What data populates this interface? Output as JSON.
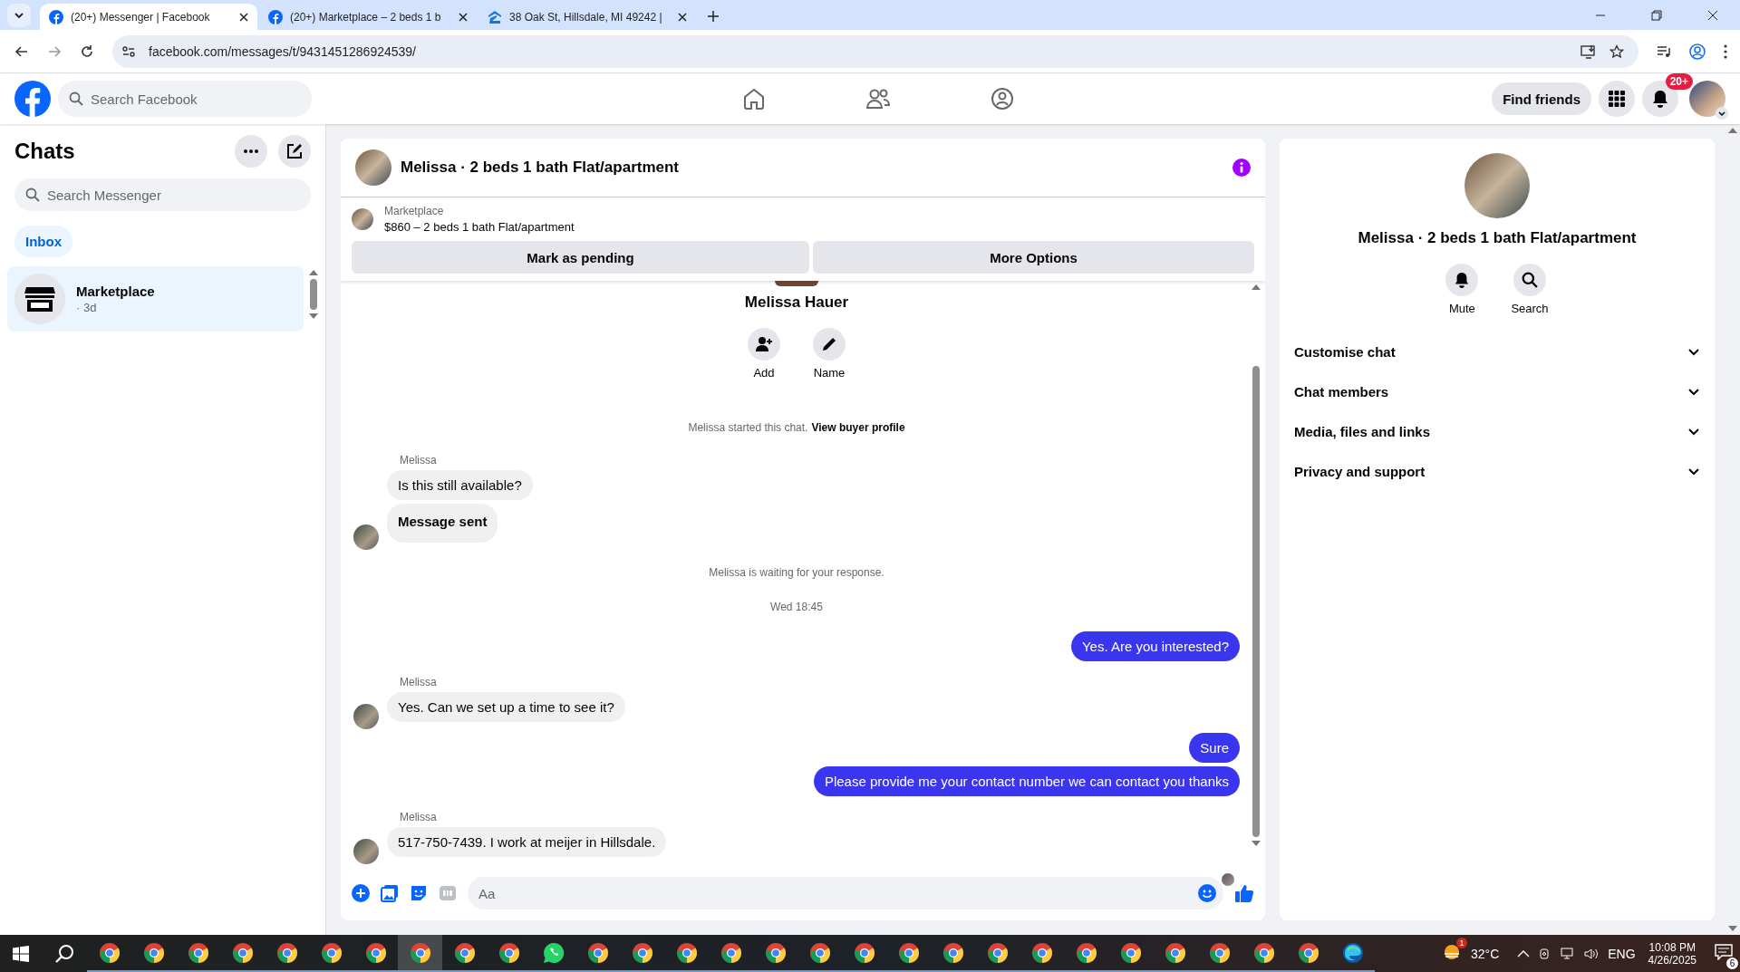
{
  "browser": {
    "tabs": [
      {
        "title": "(20+) Messenger | Facebook",
        "kind": "facebook",
        "selected": true
      },
      {
        "title": "(20+) Marketplace – 2 beds 1 b",
        "kind": "facebook",
        "selected": false
      },
      {
        "title": "38 Oak St, Hillsdale, MI 49242 |",
        "kind": "zillow",
        "selected": false
      }
    ],
    "url": "facebook.com/messages/t/9431451286924539/"
  },
  "header": {
    "search": {
      "placeholder": "Search Facebook"
    },
    "nav": [
      {
        "kind": "home"
      },
      {
        "kind": "friends"
      },
      {
        "kind": "groups"
      }
    ],
    "find_friends": "Find friends",
    "notification_badge": "20+"
  },
  "sidebar": {
    "title": "Chats",
    "search": {
      "placeholder": "Search Messenger"
    },
    "filter": {
      "label": "Inbox",
      "selected": true
    },
    "chats": [
      {
        "name": "Marketplace",
        "time": "· 3d",
        "selected": true
      }
    ]
  },
  "conversation": {
    "title": "Melissa · 2 beds 1 bath Flat/apartment",
    "listing": {
      "source": "Marketplace",
      "summary": "$860 – 2 beds 1 bath Flat/apartment"
    },
    "actions": [
      "Mark as pending",
      "More Options"
    ],
    "profile": {
      "name": "Melissa Hauer",
      "buttons": [
        {
          "label": "Add",
          "kind": "add"
        },
        {
          "label": "Name",
          "kind": "edit"
        }
      ]
    },
    "messages": [
      {
        "kind": "system",
        "text": "Melissa started this chat.",
        "link": "View buyer profile"
      },
      {
        "kind": "incoming",
        "sender": "Melissa",
        "bubbles": [
          {
            "text": "Is this still available?",
            "kind": "text"
          },
          {
            "text": "Message sent",
            "kind": "notice"
          }
        ]
      },
      {
        "kind": "system",
        "text": "Melissa is waiting for your response."
      },
      {
        "kind": "time",
        "text": "Wed 18:45"
      },
      {
        "kind": "outgoing",
        "bubbles": [
          {
            "text": "Yes. Are you interested?",
            "kind": "text"
          }
        ]
      },
      {
        "kind": "incoming",
        "sender": "Melissa",
        "bubbles": [
          {
            "text": "Yes. Can we set up a time to see it?",
            "kind": "text"
          }
        ]
      },
      {
        "kind": "outgoing",
        "bubbles": [
          {
            "text": "Sure",
            "kind": "text"
          },
          {
            "text": "Please provide me your contact number we can contact you thanks",
            "kind": "text"
          }
        ]
      },
      {
        "kind": "incoming",
        "sender": "Melissa",
        "bubbles": [
          {
            "text": "517-750-7439. I work at meijer in Hillsdale.",
            "kind": "text"
          }
        ]
      }
    ],
    "composer": {
      "placeholder": "Aa"
    }
  },
  "details": {
    "name": "Melissa · 2 beds 1 bath Flat/apartment",
    "buttons": [
      {
        "label": "Mute",
        "kind": "mute"
      },
      {
        "label": "Search",
        "kind": "search"
      }
    ],
    "sections": [
      {
        "label": "Customise chat",
        "expanded": false
      },
      {
        "label": "Chat members",
        "expanded": false
      },
      {
        "label": "Media, files and links",
        "expanded": false
      },
      {
        "label": "Privacy and support",
        "expanded": false
      }
    ]
  },
  "taskbar": {
    "apps": [
      {
        "kind": "chrome",
        "selected": false
      },
      {
        "kind": "chrome",
        "selected": false
      },
      {
        "kind": "chrome",
        "selected": false
      },
      {
        "kind": "chrome",
        "selected": false
      },
      {
        "kind": "chrome",
        "selected": false
      },
      {
        "kind": "chrome",
        "selected": false
      },
      {
        "kind": "chrome",
        "selected": false
      },
      {
        "kind": "chrome",
        "selected": true
      },
      {
        "kind": "chrome",
        "selected": false
      },
      {
        "kind": "chrome",
        "selected": false
      },
      {
        "kind": "whatsapp",
        "selected": false
      },
      {
        "kind": "chrome",
        "selected": false
      },
      {
        "kind": "chrome",
        "selected": false
      },
      {
        "kind": "chrome",
        "selected": false
      },
      {
        "kind": "chrome",
        "selected": false
      },
      {
        "kind": "chrome",
        "selected": false
      },
      {
        "kind": "chrome",
        "selected": false
      },
      {
        "kind": "chrome",
        "selected": false
      },
      {
        "kind": "chrome",
        "selected": false
      },
      {
        "kind": "chrome",
        "selected": false
      },
      {
        "kind": "chrome",
        "selected": false
      },
      {
        "kind": "chrome",
        "selected": false
      },
      {
        "kind": "chrome",
        "selected": false
      },
      {
        "kind": "chrome",
        "selected": false
      },
      {
        "kind": "chrome",
        "selected": false
      },
      {
        "kind": "chrome",
        "selected": false
      },
      {
        "kind": "chrome",
        "selected": false
      },
      {
        "kind": "chrome",
        "selected": false
      },
      {
        "kind": "edge",
        "selected": false
      }
    ],
    "weather_badge": "1",
    "temperature": "32°C",
    "language": "ENG",
    "time": "10:08 PM",
    "date": "4/26/2025",
    "notification_count": "6"
  }
}
